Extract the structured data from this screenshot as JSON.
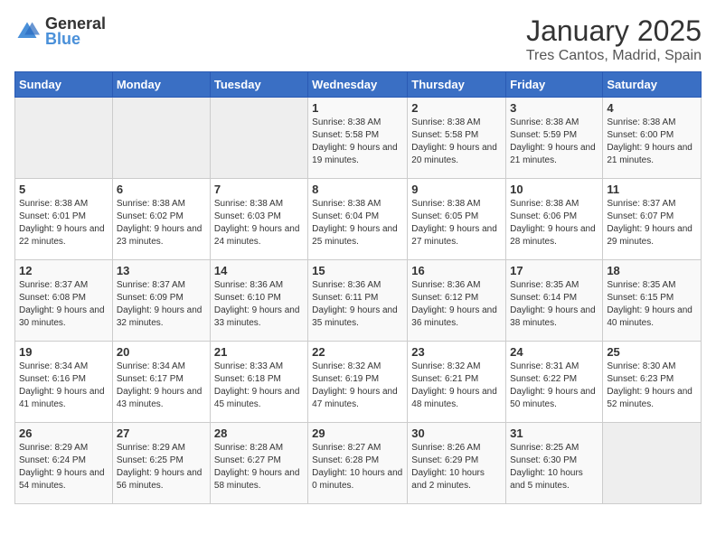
{
  "logo": {
    "text_general": "General",
    "text_blue": "Blue"
  },
  "title": "January 2025",
  "subtitle": "Tres Cantos, Madrid, Spain",
  "days_of_week": [
    "Sunday",
    "Monday",
    "Tuesday",
    "Wednesday",
    "Thursday",
    "Friday",
    "Saturday"
  ],
  "weeks": [
    [
      {
        "day": "",
        "sunrise": "",
        "sunset": "",
        "daylight": ""
      },
      {
        "day": "",
        "sunrise": "",
        "sunset": "",
        "daylight": ""
      },
      {
        "day": "",
        "sunrise": "",
        "sunset": "",
        "daylight": ""
      },
      {
        "day": "1",
        "sunrise": "8:38 AM",
        "sunset": "5:58 PM",
        "daylight": "9 hours and 19 minutes."
      },
      {
        "day": "2",
        "sunrise": "8:38 AM",
        "sunset": "5:58 PM",
        "daylight": "9 hours and 20 minutes."
      },
      {
        "day": "3",
        "sunrise": "8:38 AM",
        "sunset": "5:59 PM",
        "daylight": "9 hours and 21 minutes."
      },
      {
        "day": "4",
        "sunrise": "8:38 AM",
        "sunset": "6:00 PM",
        "daylight": "9 hours and 21 minutes."
      }
    ],
    [
      {
        "day": "5",
        "sunrise": "8:38 AM",
        "sunset": "6:01 PM",
        "daylight": "9 hours and 22 minutes."
      },
      {
        "day": "6",
        "sunrise": "8:38 AM",
        "sunset": "6:02 PM",
        "daylight": "9 hours and 23 minutes."
      },
      {
        "day": "7",
        "sunrise": "8:38 AM",
        "sunset": "6:03 PM",
        "daylight": "9 hours and 24 minutes."
      },
      {
        "day": "8",
        "sunrise": "8:38 AM",
        "sunset": "6:04 PM",
        "daylight": "9 hours and 25 minutes."
      },
      {
        "day": "9",
        "sunrise": "8:38 AM",
        "sunset": "6:05 PM",
        "daylight": "9 hours and 27 minutes."
      },
      {
        "day": "10",
        "sunrise": "8:38 AM",
        "sunset": "6:06 PM",
        "daylight": "9 hours and 28 minutes."
      },
      {
        "day": "11",
        "sunrise": "8:37 AM",
        "sunset": "6:07 PM",
        "daylight": "9 hours and 29 minutes."
      }
    ],
    [
      {
        "day": "12",
        "sunrise": "8:37 AM",
        "sunset": "6:08 PM",
        "daylight": "9 hours and 30 minutes."
      },
      {
        "day": "13",
        "sunrise": "8:37 AM",
        "sunset": "6:09 PM",
        "daylight": "9 hours and 32 minutes."
      },
      {
        "day": "14",
        "sunrise": "8:36 AM",
        "sunset": "6:10 PM",
        "daylight": "9 hours and 33 minutes."
      },
      {
        "day": "15",
        "sunrise": "8:36 AM",
        "sunset": "6:11 PM",
        "daylight": "9 hours and 35 minutes."
      },
      {
        "day": "16",
        "sunrise": "8:36 AM",
        "sunset": "6:12 PM",
        "daylight": "9 hours and 36 minutes."
      },
      {
        "day": "17",
        "sunrise": "8:35 AM",
        "sunset": "6:14 PM",
        "daylight": "9 hours and 38 minutes."
      },
      {
        "day": "18",
        "sunrise": "8:35 AM",
        "sunset": "6:15 PM",
        "daylight": "9 hours and 40 minutes."
      }
    ],
    [
      {
        "day": "19",
        "sunrise": "8:34 AM",
        "sunset": "6:16 PM",
        "daylight": "9 hours and 41 minutes."
      },
      {
        "day": "20",
        "sunrise": "8:34 AM",
        "sunset": "6:17 PM",
        "daylight": "9 hours and 43 minutes."
      },
      {
        "day": "21",
        "sunrise": "8:33 AM",
        "sunset": "6:18 PM",
        "daylight": "9 hours and 45 minutes."
      },
      {
        "day": "22",
        "sunrise": "8:32 AM",
        "sunset": "6:19 PM",
        "daylight": "9 hours and 47 minutes."
      },
      {
        "day": "23",
        "sunrise": "8:32 AM",
        "sunset": "6:21 PM",
        "daylight": "9 hours and 48 minutes."
      },
      {
        "day": "24",
        "sunrise": "8:31 AM",
        "sunset": "6:22 PM",
        "daylight": "9 hours and 50 minutes."
      },
      {
        "day": "25",
        "sunrise": "8:30 AM",
        "sunset": "6:23 PM",
        "daylight": "9 hours and 52 minutes."
      }
    ],
    [
      {
        "day": "26",
        "sunrise": "8:29 AM",
        "sunset": "6:24 PM",
        "daylight": "9 hours and 54 minutes."
      },
      {
        "day": "27",
        "sunrise": "8:29 AM",
        "sunset": "6:25 PM",
        "daylight": "9 hours and 56 minutes."
      },
      {
        "day": "28",
        "sunrise": "8:28 AM",
        "sunset": "6:27 PM",
        "daylight": "9 hours and 58 minutes."
      },
      {
        "day": "29",
        "sunrise": "8:27 AM",
        "sunset": "6:28 PM",
        "daylight": "10 hours and 0 minutes."
      },
      {
        "day": "30",
        "sunrise": "8:26 AM",
        "sunset": "6:29 PM",
        "daylight": "10 hours and 2 minutes."
      },
      {
        "day": "31",
        "sunrise": "8:25 AM",
        "sunset": "6:30 PM",
        "daylight": "10 hours and 5 minutes."
      },
      {
        "day": "",
        "sunrise": "",
        "sunset": "",
        "daylight": ""
      }
    ]
  ]
}
